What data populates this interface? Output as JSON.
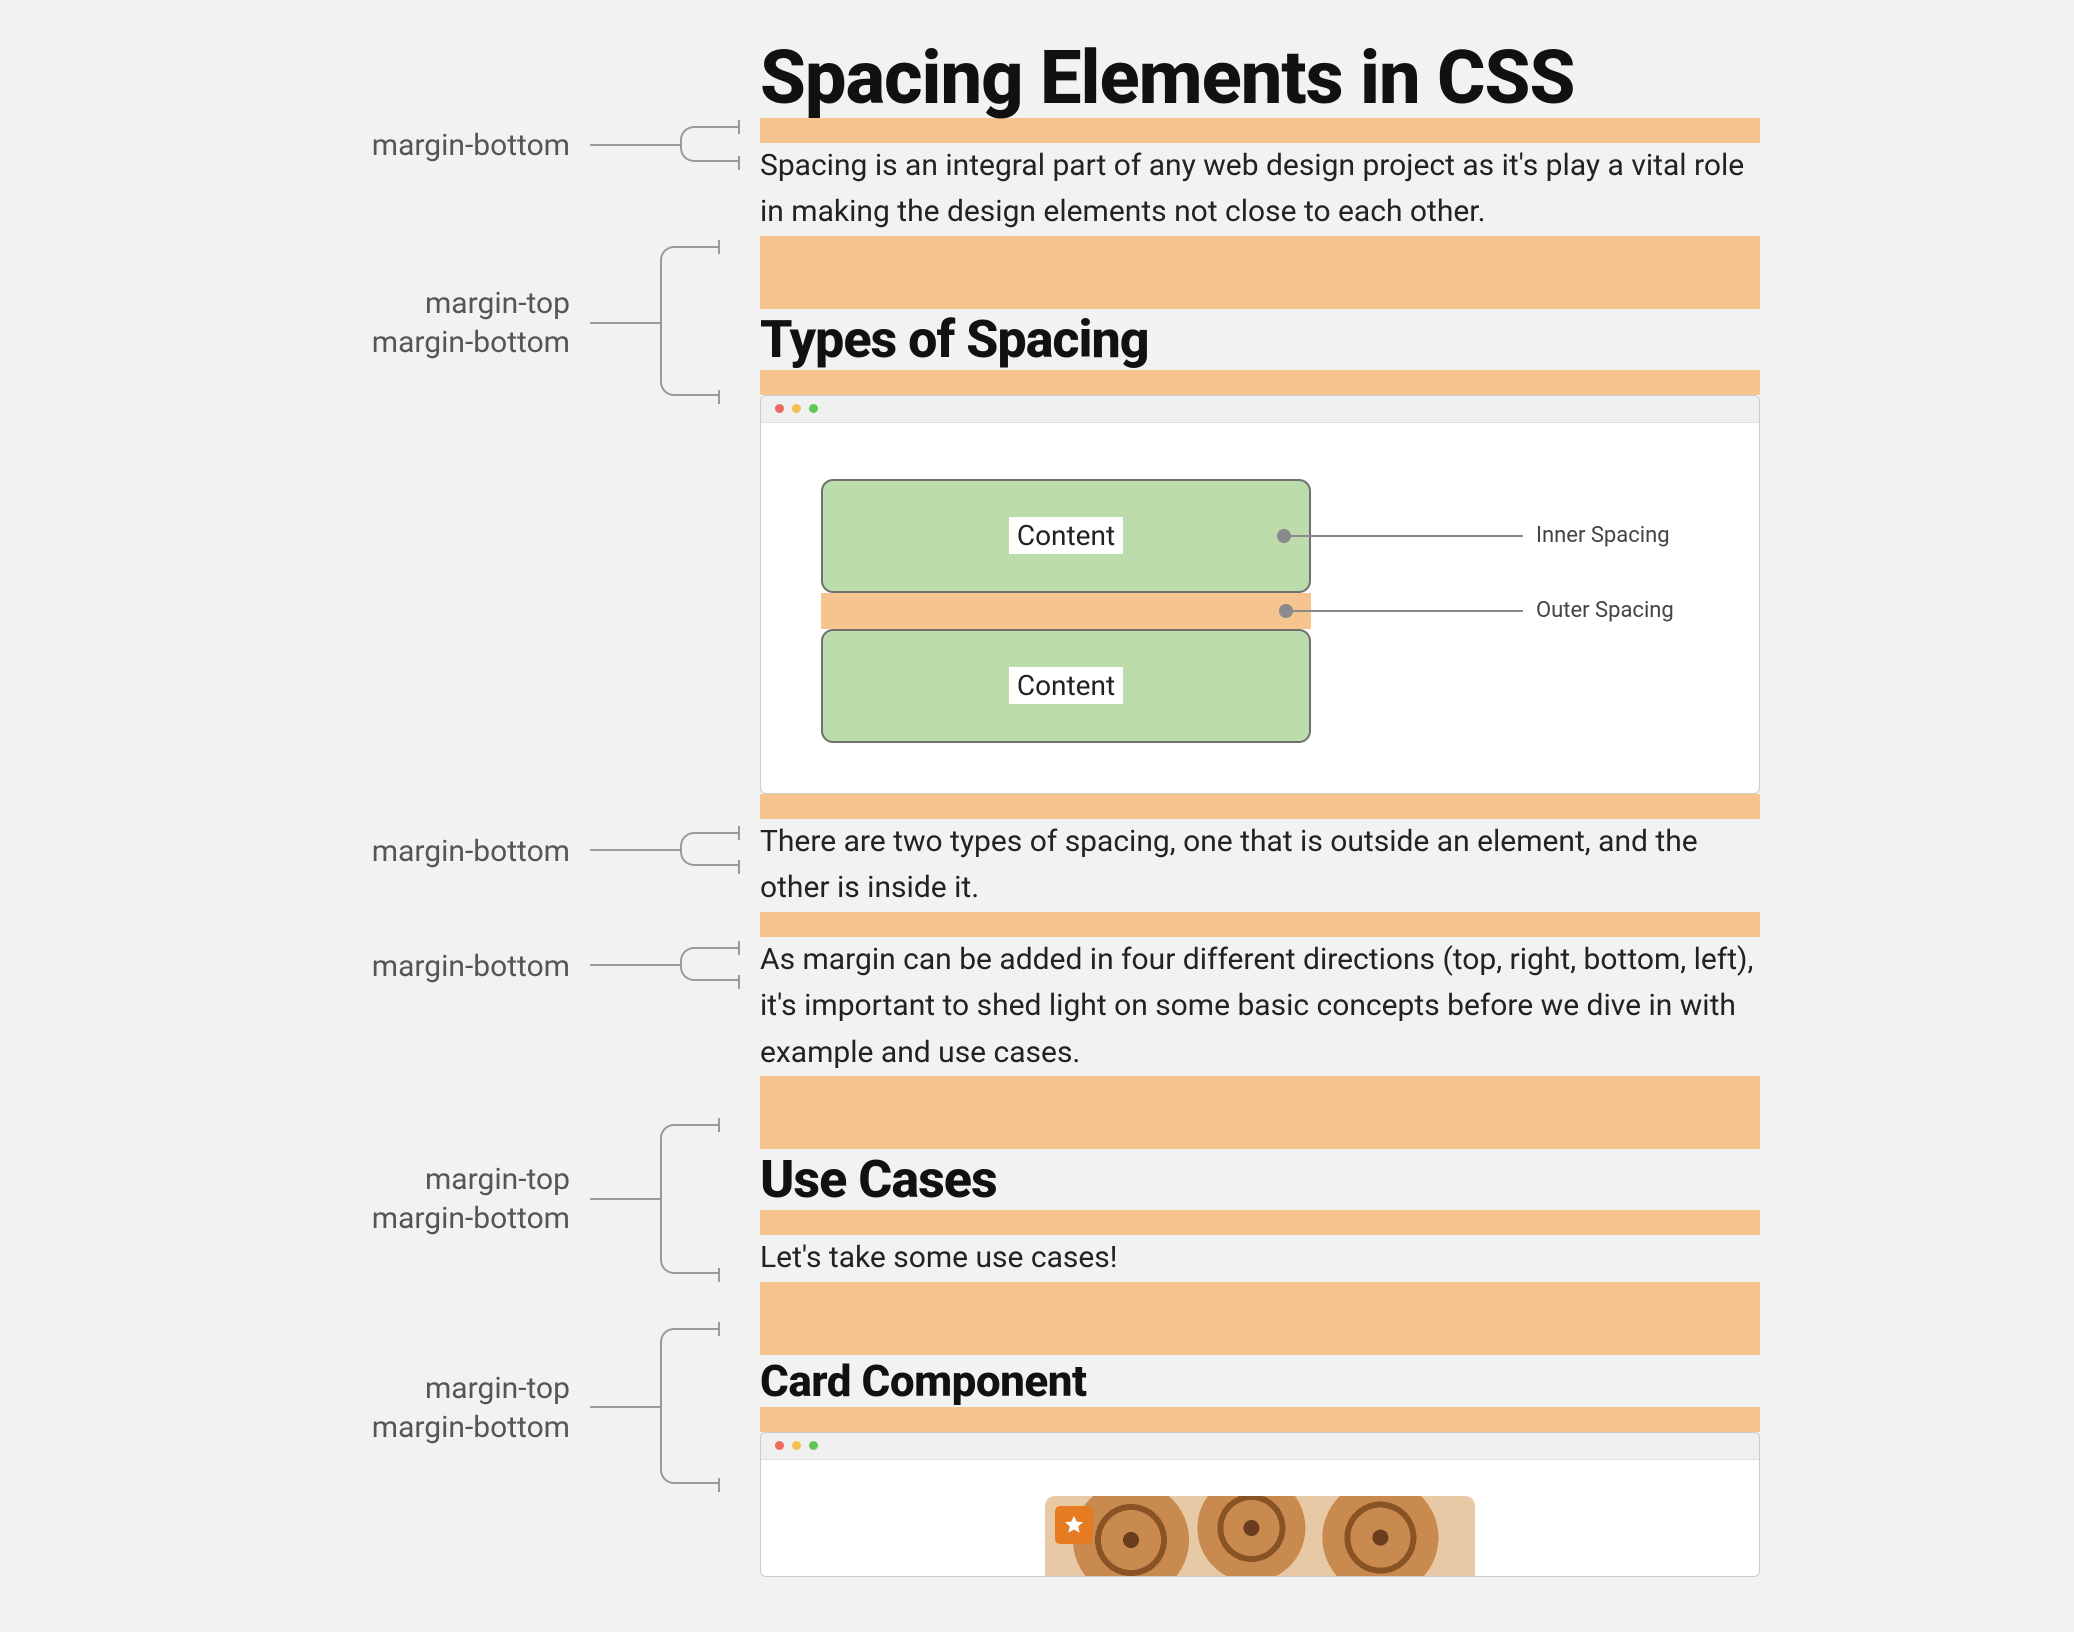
{
  "annotations": {
    "a1": "margin-bottom",
    "a2_line1": "margin-top",
    "a2_line2": "margin-bottom",
    "a3": "margin-bottom",
    "a4": "margin-bottom",
    "a5_line1": "margin-top",
    "a5_line2": "margin-bottom",
    "a6_line1": "margin-top",
    "a6_line2": "margin-bottom"
  },
  "article": {
    "h1": "Spacing Elements in CSS",
    "p1": "Spacing is an integral part of any web design project as it's play a vital role in making the design elements not close to each other.",
    "h2_types": "Types of Spacing",
    "diagram": {
      "box1": "Content",
      "box2": "Content",
      "inner_label": "Inner Spacing",
      "outer_label": "Outer Spacing"
    },
    "p2": "There are two types of spacing, one that is outside an element, and the other is inside it.",
    "p3": "As margin can be added in four different directions (top, right, bottom, left), it's important to shed light on some basic concepts before we dive in with example and use cases.",
    "h2_usecases": "Use Cases",
    "p4": "Let's take some use cases!",
    "h3_card": "Card Component"
  },
  "icons": {
    "star": "star-icon",
    "window_red": "close",
    "window_yellow": "minimize",
    "window_green": "zoom"
  },
  "colors": {
    "margin_highlight": "#f6c48f",
    "padding_highlight": "#bcdcac",
    "accent": "#e77b22"
  }
}
